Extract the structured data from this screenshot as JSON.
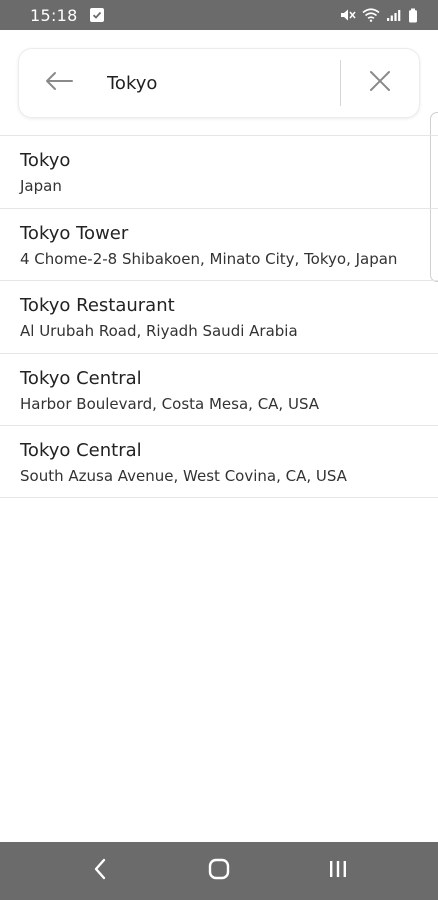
{
  "status_bar": {
    "time": "15:18",
    "icons": [
      "notification-icon",
      "mute-icon",
      "wifi-icon",
      "signal-icon",
      "battery-icon"
    ]
  },
  "search": {
    "value": "Tokyo",
    "icons": {
      "back": "arrow-left-icon",
      "clear": "close-icon"
    }
  },
  "results": [
    {
      "title": "Tokyo",
      "subtitle": "Japan"
    },
    {
      "title": "Tokyo Tower",
      "subtitle": "4 Chome-2-8 Shibakoen, Minato City, Tokyo, Japan"
    },
    {
      "title": "Tokyo Restaurant",
      "subtitle": "Al Urubah Road, Riyadh Saudi Arabia"
    },
    {
      "title": "Tokyo Central",
      "subtitle": "Harbor Boulevard, Costa Mesa, CA, USA"
    },
    {
      "title": "Tokyo Central",
      "subtitle": "South Azusa Avenue, West Covina, CA, USA"
    }
  ],
  "nav_bar": {
    "icons": [
      "back-nav-icon",
      "home-icon",
      "recents-icon"
    ]
  },
  "colors": {
    "system_bar": "#6b6b6b",
    "background": "#ffffff",
    "divider": "#e6e6e6",
    "icon_gray": "#8a8a8a"
  }
}
